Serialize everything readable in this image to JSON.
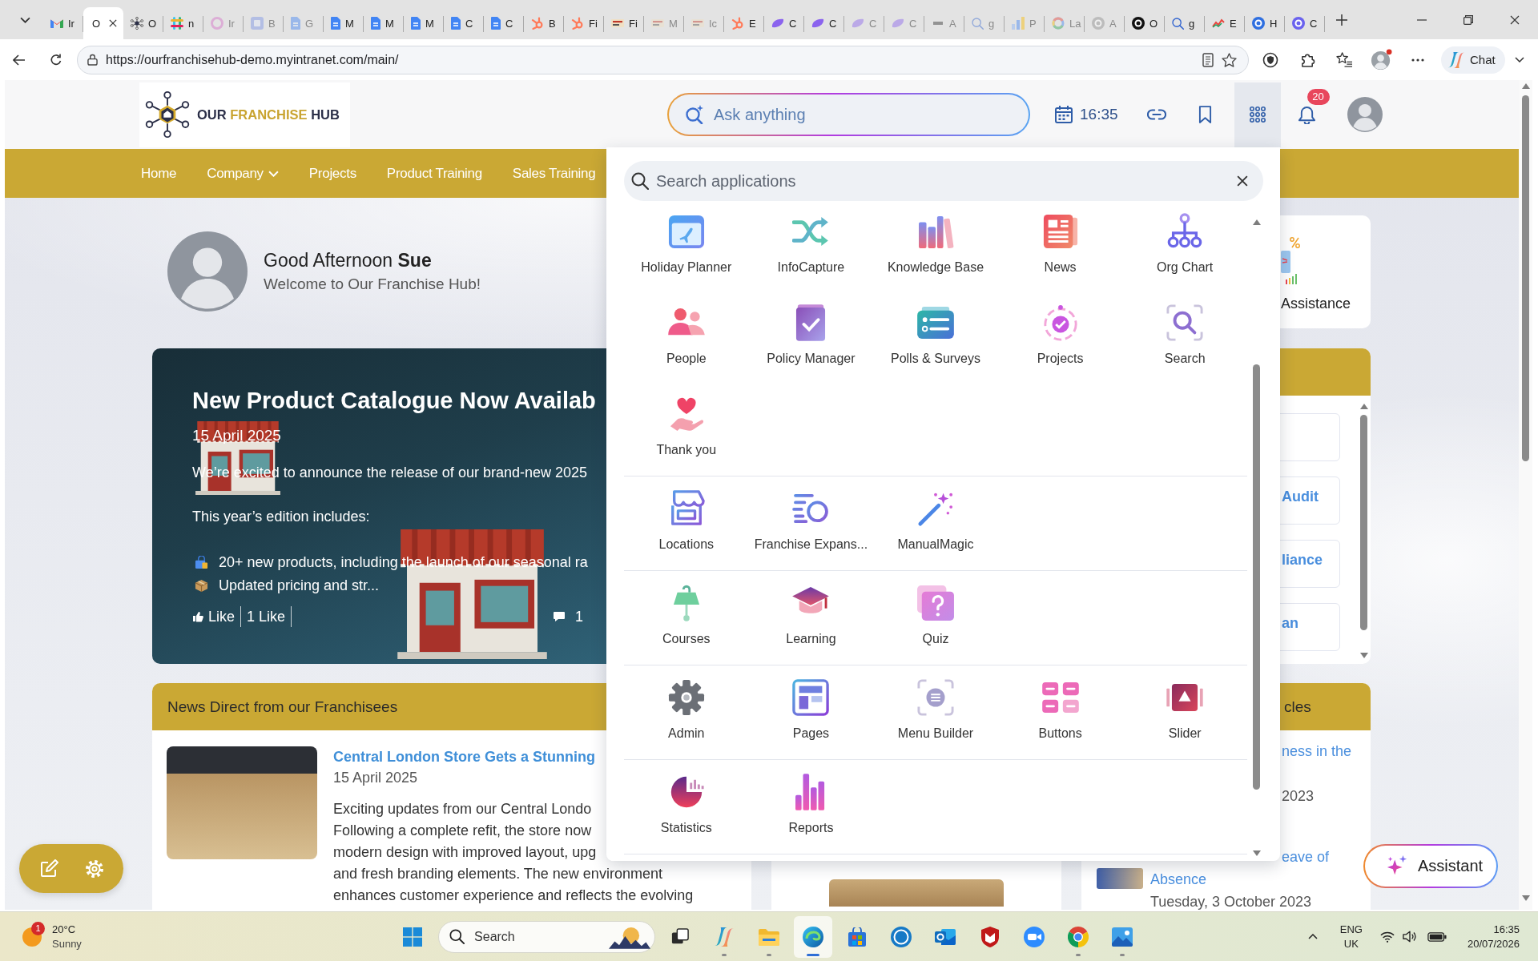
{
  "browser": {
    "tabs": [
      {
        "label": "Ir",
        "selected": false,
        "sleeping": false
      },
      {
        "label": "O",
        "selected": true,
        "sleeping": false
      },
      {
        "label": "O",
        "selected": false,
        "sleeping": false
      },
      {
        "label": "n",
        "selected": false,
        "sleeping": false
      },
      {
        "label": "Ir",
        "selected": false,
        "sleeping": true
      },
      {
        "label": "B",
        "selected": false,
        "sleeping": true
      },
      {
        "label": "G",
        "selected": false,
        "sleeping": true
      },
      {
        "label": "M",
        "selected": false,
        "sleeping": false
      },
      {
        "label": "M",
        "selected": false,
        "sleeping": false
      },
      {
        "label": "M",
        "selected": false,
        "sleeping": false
      },
      {
        "label": "C",
        "selected": false,
        "sleeping": false
      },
      {
        "label": "C",
        "selected": false,
        "sleeping": false
      },
      {
        "label": "B",
        "selected": false,
        "sleeping": false
      },
      {
        "label": "Fi",
        "selected": false,
        "sleeping": false
      },
      {
        "label": "Fi",
        "selected": false,
        "sleeping": false
      },
      {
        "label": "M",
        "selected": false,
        "sleeping": true
      },
      {
        "label": "Ic",
        "selected": false,
        "sleeping": true
      },
      {
        "label": "E",
        "selected": false,
        "sleeping": false
      },
      {
        "label": "C",
        "selected": false,
        "sleeping": false
      },
      {
        "label": "C",
        "selected": false,
        "sleeping": false
      },
      {
        "label": "C",
        "selected": false,
        "sleeping": true
      },
      {
        "label": "C",
        "selected": false,
        "sleeping": true
      },
      {
        "label": "A",
        "selected": false,
        "sleeping": true
      },
      {
        "label": "g",
        "selected": false,
        "sleeping": true
      },
      {
        "label": "P",
        "selected": false,
        "sleeping": true
      },
      {
        "label": "La",
        "selected": false,
        "sleeping": true
      },
      {
        "label": "A",
        "selected": false,
        "sleeping": true
      },
      {
        "label": "O",
        "selected": false,
        "sleeping": false
      },
      {
        "label": "g",
        "selected": false,
        "sleeping": false
      },
      {
        "label": "E",
        "selected": false,
        "sleeping": false
      },
      {
        "label": "H",
        "selected": false,
        "sleeping": false
      },
      {
        "label": "C",
        "selected": false,
        "sleeping": false
      }
    ],
    "address_bar": {
      "url": "https://ourfranchisehub-demo.myintranet.com/main/"
    },
    "chat_button": {
      "label": "Chat"
    }
  },
  "header": {
    "logo": {
      "words": [
        {
          "text": "OUR",
          "accent": false
        },
        {
          "text": "FRANCHISE",
          "accent": true
        },
        {
          "text": "HUB",
          "accent": false
        }
      ]
    },
    "ask_field": {
      "placeholder": "Ask anything"
    },
    "time": "16:35",
    "apps_button": {
      "expanded": true
    },
    "notifications": {
      "count": "20"
    }
  },
  "nav": {
    "items": [
      {
        "label": "Home",
        "has_menu": false
      },
      {
        "label": "Company",
        "has_menu": true
      },
      {
        "label": "Projects",
        "has_menu": false
      },
      {
        "label": "Product Training",
        "has_menu": false
      },
      {
        "label": "Sales Training",
        "has_menu": false
      }
    ]
  },
  "greeting": {
    "title": "Good Afternoon **Sue**",
    "subtitle": "Welcome to Our Franchise Hub!"
  },
  "hero": {
    "title": "New Product Catalogue Now Availab",
    "date": "15 April 2025",
    "paragraphs": [
      "We’re excited to announce the release of our brand-new 2025",
      "This year’s edition includes:"
    ],
    "bullets": [
      "20+ new products, including the launch of our seasonal ra",
      "Updated pricing and str..."
    ],
    "like_button": {
      "label": "Like"
    },
    "like_count": "1 Like",
    "comment_count": "1"
  },
  "news_card": {
    "title": "News Direct from our Franchisees",
    "article": {
      "title": "Central London Store Gets a Stunning",
      "date": "15 April 2025",
      "lines": [
        "Exciting updates from our Central Londo",
        "Following a complete refit, the store now",
        "modern design with improved layout, upg",
        "and fresh branding elements. The new environment",
        "enhances customer experience and reflects the evolving"
      ]
    }
  },
  "side_tile": {
    "label": "Assistance"
  },
  "side_list": {
    "items": [
      {
        "title": "Audit"
      },
      {
        "title": "liance"
      },
      {
        "title": "an"
      }
    ]
  },
  "side_articles": {
    "title": "cles",
    "articles": [
      {
        "title_lines": [
          "ness in the"
        ],
        "date": "2023"
      },
      {
        "thumbnail": true,
        "title_lines": [
          "eave of",
          "Absence"
        ],
        "date": "Tuesday, 3 October 2023"
      }
    ]
  },
  "app_menu": {
    "search": {
      "placeholder": "Search applications"
    },
    "sections": [
      {
        "apps": [
          {
            "label": "Holiday Planner"
          },
          {
            "label": "InfoCapture"
          },
          {
            "label": "Knowledge Base"
          },
          {
            "label": "News"
          },
          {
            "label": "Org Chart"
          },
          {
            "label": "People"
          },
          {
            "label": "Policy Manager"
          },
          {
            "label": "Polls & Surveys"
          },
          {
            "label": "Projects"
          },
          {
            "label": "Search"
          },
          {
            "label": "Thank you"
          }
        ]
      },
      {
        "apps": [
          {
            "label": "Locations"
          },
          {
            "label": "Franchise Expans..."
          },
          {
            "label": "ManualMagic"
          }
        ]
      },
      {
        "apps": [
          {
            "label": "Courses"
          },
          {
            "label": "Learning"
          },
          {
            "label": "Quiz"
          }
        ]
      },
      {
        "apps": [
          {
            "label": "Admin"
          },
          {
            "label": "Pages"
          },
          {
            "label": "Menu Builder"
          },
          {
            "label": "Buttons"
          },
          {
            "label": "Slider"
          }
        ]
      },
      {
        "apps": [
          {
            "label": "Statistics"
          },
          {
            "label": "Reports"
          }
        ]
      }
    ]
  },
  "assistant_button": {
    "label": "Assistant"
  },
  "taskbar": {
    "weather": {
      "alerts": "1",
      "temperature": "20°C",
      "condition": "Sunny"
    },
    "search": {
      "placeholder": "Search"
    },
    "apps": [
      {
        "running": false,
        "selected": false
      },
      {
        "running": true,
        "selected": false
      },
      {
        "running": true,
        "selected": false
      },
      {
        "running": true,
        "selected": true
      },
      {
        "running": false,
        "selected": false
      },
      {
        "running": false,
        "selected": false
      },
      {
        "running": false,
        "selected": false
      },
      {
        "running": false,
        "selected": false
      },
      {
        "running": false,
        "selected": false
      },
      {
        "running": true,
        "selected": false
      },
      {
        "running": true,
        "selected": false
      }
    ],
    "tray": {
      "language": "ENG",
      "region": "UK"
    },
    "clock": {
      "time": "16:35",
      "date": "20/07/2026"
    }
  }
}
